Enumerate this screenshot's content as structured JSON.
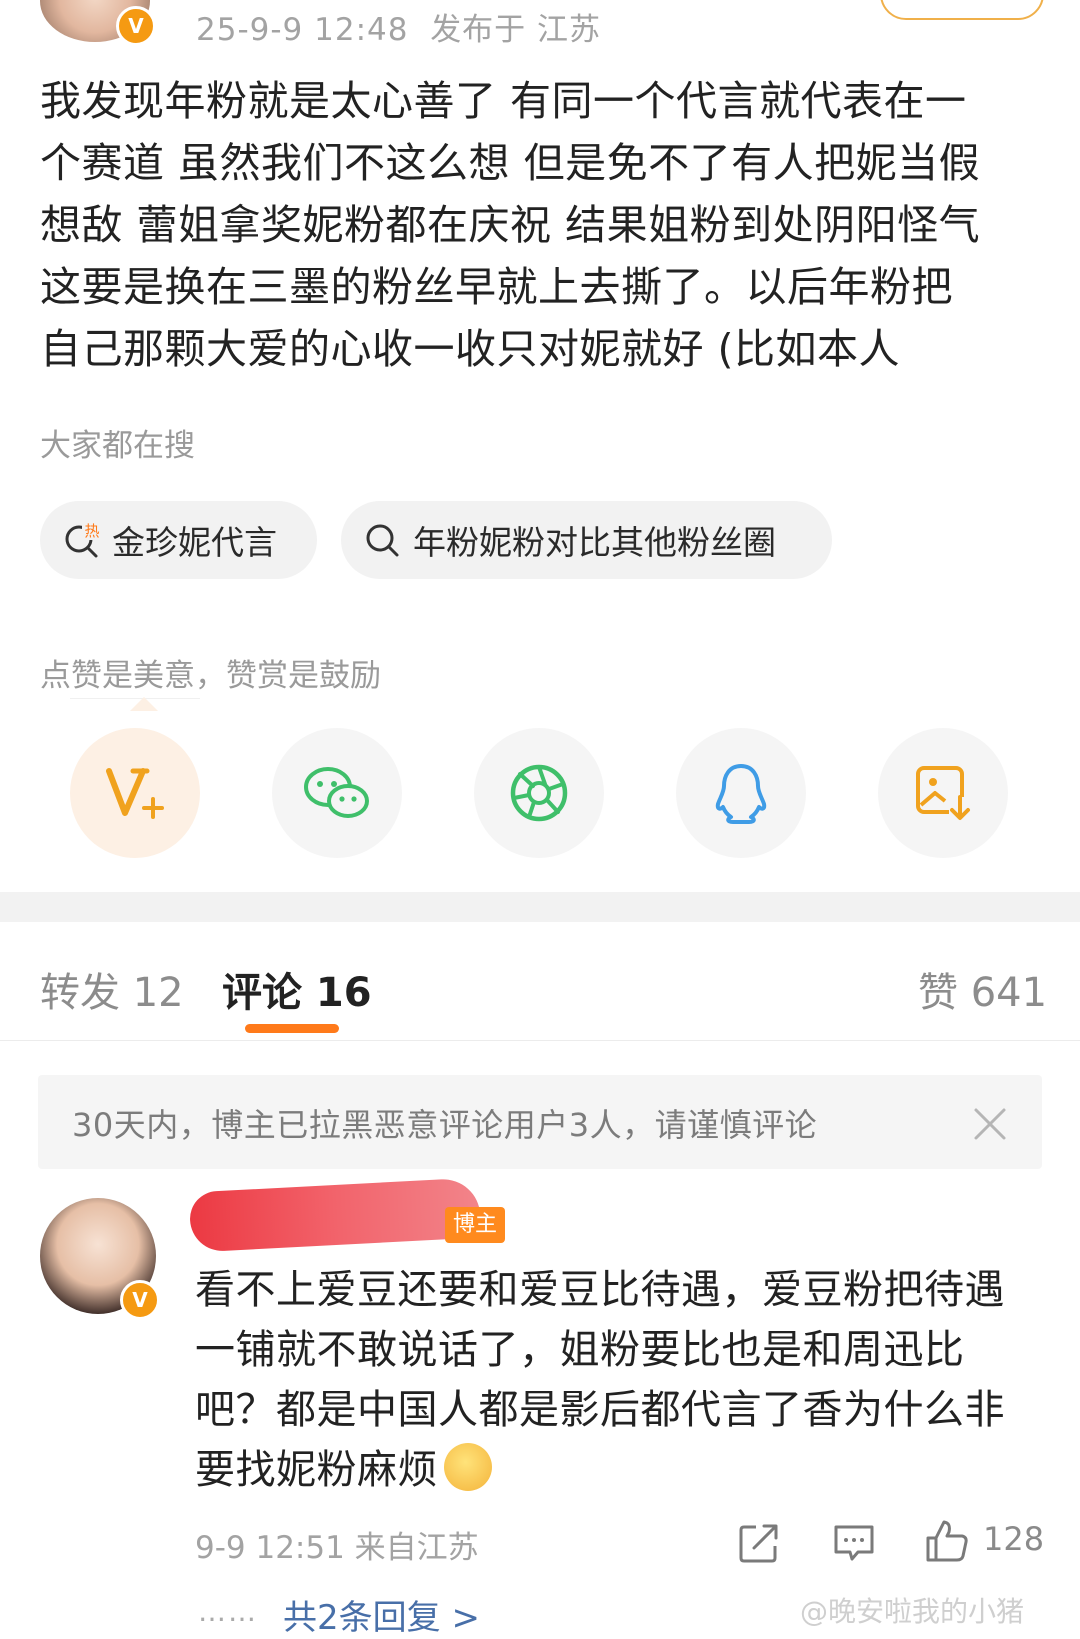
{
  "post": {
    "timestamp": "25-9-9 12:48",
    "location": "发布于 江苏",
    "badge_letter": "V",
    "lines": [
      "我发现年粉就是太心善了 有同一个代言就代表在一",
      "个赛道 虽然我们不这么想 但是免不了有人把妮当假",
      "想敌 蕾姐拿奖妮粉都在庆祝 结果姐粉到处阴阳怪气",
      "这要是换在三墨的粉丝早就上去撕了。以后年粉把",
      "自己那颗大爱的心收一收只对妮就好 (比如本人"
    ]
  },
  "search": {
    "label": "大家都在搜",
    "hot_tag": "热",
    "chips": [
      "金珍妮代言",
      "年粉妮粉对比其他粉丝圈"
    ]
  },
  "reward": {
    "label": "点赞是美意，赞赏是鼓励",
    "icons": [
      "vplus-icon",
      "wechat-icon",
      "moments-icon",
      "qq-icon",
      "save-image-icon"
    ]
  },
  "tabs": {
    "repost": "转发 12",
    "comment": "评论 16",
    "likes": "赞 641"
  },
  "notice": {
    "text": "30天内，博主已拉黑恶意评论用户3人，请谨慎评论"
  },
  "comment": {
    "author_badge": "博主",
    "lines": [
      "看不上爱豆还要和爱豆比待遇，爱豆粉把待遇",
      "一铺就不敢说话了，姐粉要比也是和周迅比",
      "吧？都是中国人都是影后都代言了香为什么非",
      "要找妮粉麻烦"
    ],
    "meta": "9-9 12:51 来自江苏",
    "like_count": "128",
    "replies_dots": "……",
    "replies_link": "共2条回复 >"
  },
  "watermark": "@晚安啦我的小猪",
  "colors": {
    "accent": "#ff7a1a",
    "link": "#486fa8",
    "wechat": "#3fbf6a",
    "qq": "#3f9ce6",
    "gold": "#f0a21e"
  }
}
